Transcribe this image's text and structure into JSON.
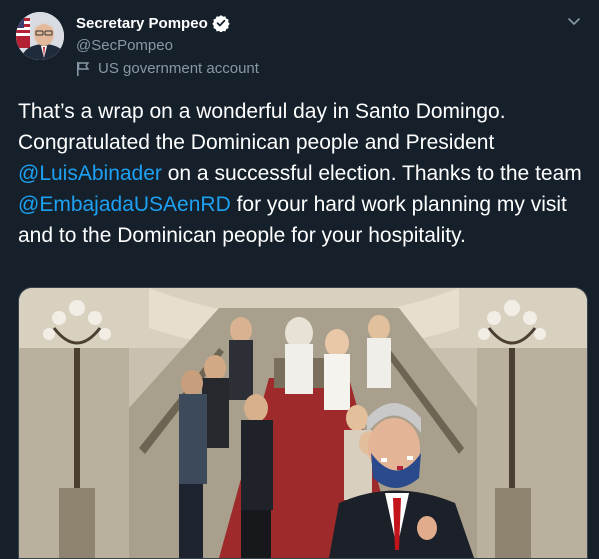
{
  "account": {
    "display_name": "Secretary Pompeo",
    "handle": "@SecPompeo",
    "label": "US government account",
    "verified_icon": "verified-badge-icon",
    "label_icon": "flag-icon"
  },
  "tweet": {
    "text_before_mention_1": "That’s a wrap on a wonderful day in Santo Domingo. Congratulated the Dominican people and President ",
    "mention_1": "@LuisAbinader",
    "text_between_mentions": " on a successful election. Thanks to the team ",
    "mention_2": "@EmbajadaUSAenRD",
    "text_after_mention_2": " for your hard work planning my visit and to the Dominican people for your hospitality."
  },
  "colors": {
    "background": "#15202b",
    "link": "#1da1f2",
    "secondary_text": "#8899a6",
    "primary_text": "#ffffff"
  },
  "media": {
    "type": "photo"
  }
}
